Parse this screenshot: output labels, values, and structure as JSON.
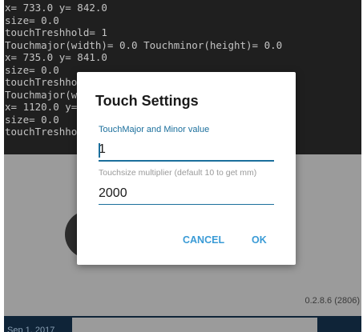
{
  "log": {
    "lines": [
      "x= 733.0 y= 842.0",
      "size= 0.0",
      "touchTreshhold= 1",
      "Touchmajor(width)= 0.0 Touchminor(height)= 0.0",
      "x= 735.0 y= 841.0",
      "size= 0.0",
      "touchTreshho",
      "Touchmajor(w",
      "x= 1120.0 y=",
      "size= 0.0",
      "touchTreshho"
    ]
  },
  "app": {
    "version": "0.2.8.6 (2806)",
    "date": "Sep 1, 2017"
  },
  "dialog": {
    "title": "Touch Settings",
    "field1_label": "TouchMajor and Minor value",
    "field1_value": "1",
    "field2_label": "Touchsize multiplier (default 10 to get mm)",
    "field2_value": "2000",
    "cancel_label": "CANCEL",
    "ok_label": "OK"
  },
  "colors": {
    "accent": "#1b6f9c",
    "button_text": "#3a9bd6"
  }
}
